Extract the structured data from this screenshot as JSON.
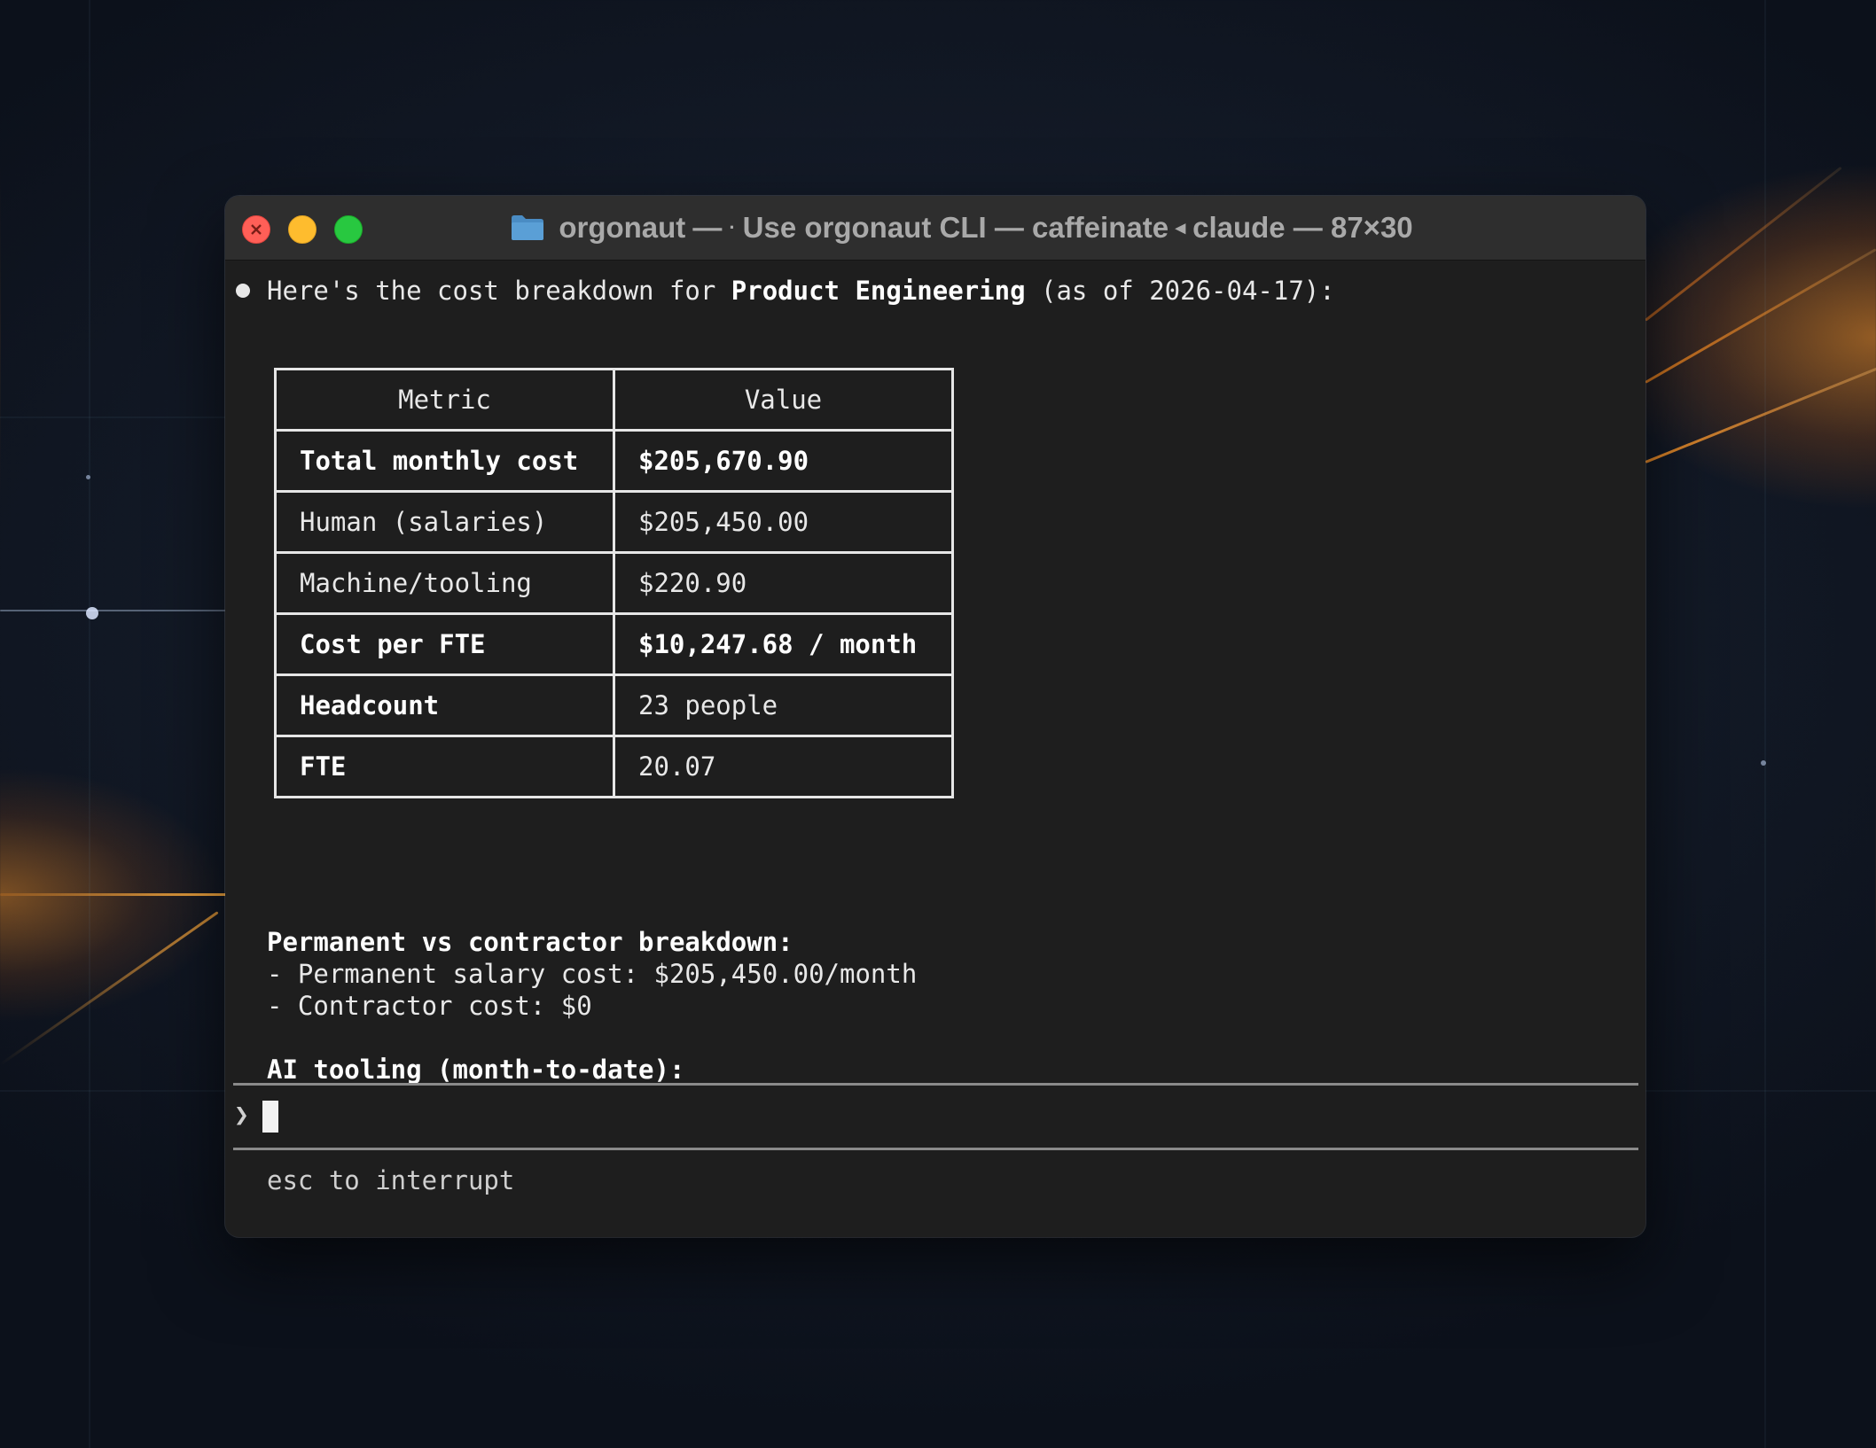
{
  "window": {
    "title_dir": "orgonaut",
    "title_sep1": " — ",
    "title_dot": "·",
    "title_rest": " Use orgonaut CLI — caffeinate",
    "title_arrow": " ◂ ",
    "title_tail": "claude — 87×30"
  },
  "message": {
    "prefix": "Here's the cost breakdown for ",
    "team": "Product Engineering",
    "suffix": " (as of 2026-04-17):"
  },
  "table": {
    "headers": [
      "Metric",
      "Value"
    ],
    "rows": [
      {
        "metric": "Total monthly cost",
        "value": "$205,670.90"
      },
      {
        "metric": "Human (salaries)",
        "value": "$205,450.00"
      },
      {
        "metric": "Machine/tooling",
        "value": "$220.90"
      },
      {
        "metric": "Cost per FTE",
        "value": "$10,247.68 / month"
      },
      {
        "metric": "Headcount",
        "value": "23 people"
      },
      {
        "metric": "FTE",
        "value": "20.07"
      }
    ]
  },
  "breakdown": {
    "heading": "Permanent vs contractor breakdown:",
    "permanent": "- Permanent salary cost: $205,450.00/month",
    "contractor": "- Contractor cost: $0"
  },
  "ai_tooling": {
    "heading": "AI tooling (month-to-date):"
  },
  "prompt": {
    "glyph": "❯",
    "hint": "esc to interrupt"
  },
  "colors": {
    "terminal_bg": "#1e1e1e",
    "titlebar_bg": "#2e2e2e",
    "close": "#ff5f57",
    "minimize": "#febc2e",
    "zoom": "#28c840",
    "folder": "#4a90c8"
  },
  "icons": {
    "folder": "folder-icon",
    "close": "close-icon",
    "bullet": "bullet-dot-icon",
    "prompt": "prompt-chevron-icon"
  }
}
